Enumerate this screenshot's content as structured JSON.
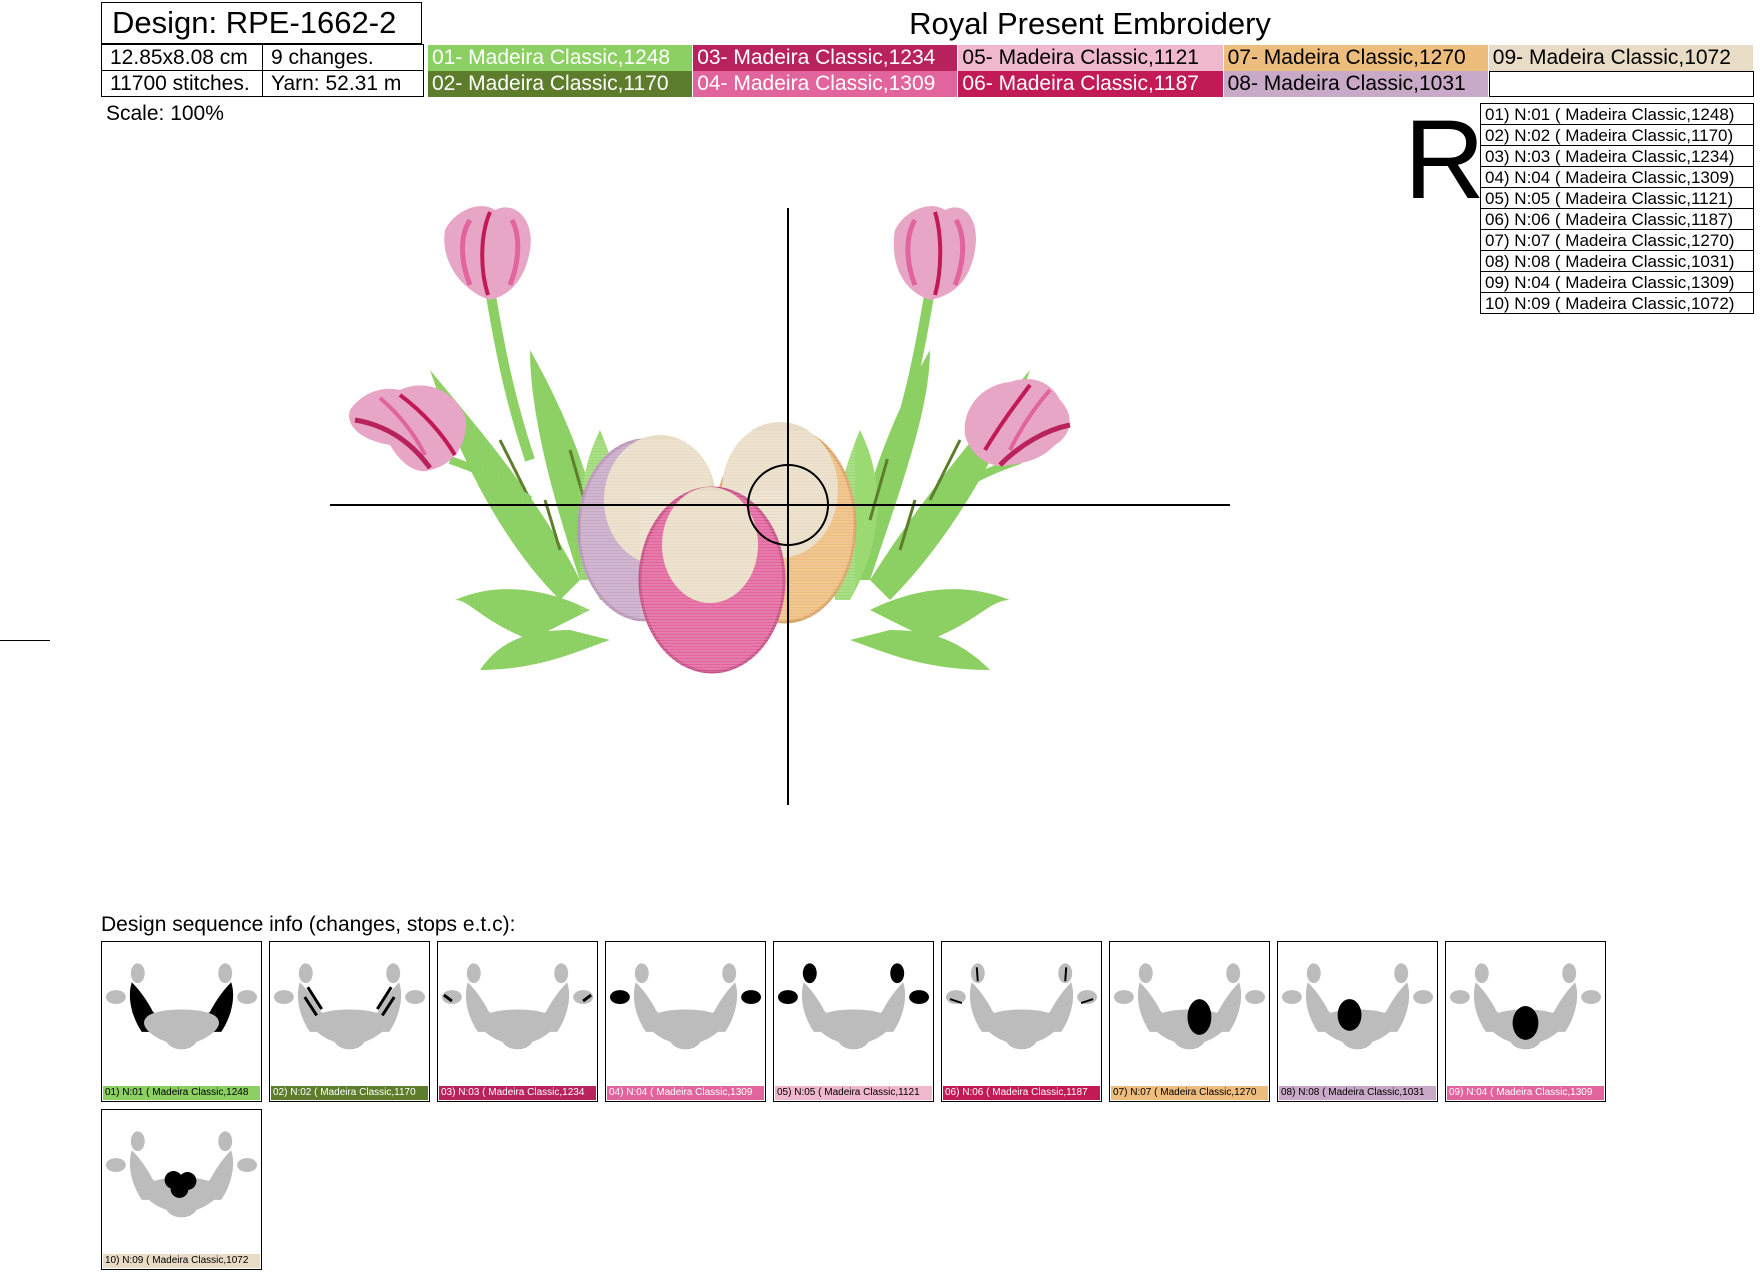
{
  "header": {
    "design": "Design: RPE-1662-2",
    "company": "Royal Present Embroidery",
    "size": "12.85x8.08 cm",
    "changes": "9 changes.",
    "stitches": "11700 stitches.",
    "yarn": "Yarn: 52.31 m",
    "scale": "Scale: 100%",
    "orientation": "R"
  },
  "palette": [
    {
      "label": "01- Madeira Classic,1248",
      "color": "#8ccf62",
      "text": "#ffffff"
    },
    {
      "label": "03- Madeira Classic,1234",
      "color": "#b9235d",
      "text": "#ffffff"
    },
    {
      "label": "05- Madeira Classic,1121",
      "color": "#f0b8cc",
      "text": "#000000"
    },
    {
      "label": "07- Madeira Classic,1270",
      "color": "#edbd7e",
      "text": "#000000"
    },
    {
      "label": "09- Madeira Classic,1072",
      "color": "#e9dcc6",
      "text": "#000000"
    },
    {
      "label": "02- Madeira Classic,1170",
      "color": "#5e7d2c",
      "text": "#ffffff"
    },
    {
      "label": "04- Madeira Classic,1309",
      "color": "#e1659c",
      "text": "#ffffff"
    },
    {
      "label": "06- Madeira Classic,1187",
      "color": "#c11a57",
      "text": "#ffffff"
    },
    {
      "label": "08- Madeira Classic,1031",
      "color": "#c9a9c8",
      "text": "#000000"
    },
    {
      "label": "",
      "color": "#ffffff",
      "text": "#000000"
    }
  ],
  "thread_list": [
    "01) N:01 ( Madeira Classic,1248)",
    "02) N:02 ( Madeira Classic,1170)",
    "03) N:03 ( Madeira Classic,1234)",
    "04) N:04 ( Madeira Classic,1309)",
    "05) N:05 ( Madeira Classic,1121)",
    "06) N:06 ( Madeira Classic,1187)",
    "07) N:07 ( Madeira Classic,1270)",
    "08) N:08 ( Madeira Classic,1031)",
    "09) N:04 ( Madeira Classic,1309)",
    "10) N:09 ( Madeira Classic,1072)"
  ],
  "sequence": {
    "title": "Design sequence info (changes, stops e.t.c):",
    "steps": [
      {
        "label": "01) N:01 ( Madeira Classic,1248",
        "color": "#8ccf62",
        "text": "#000000",
        "highlight": "leaves"
      },
      {
        "label": "02) N:02 ( Madeira Classic,1170",
        "color": "#5e7d2c",
        "text": "#ffffff",
        "highlight": "leaf-stripes"
      },
      {
        "label": "03) N:03 ( Madeira Classic,1234",
        "color": "#b9235d",
        "text": "#ffffff",
        "highlight": "side-tulip-edges"
      },
      {
        "label": "04) N:04 ( Madeira Classic,1309",
        "color": "#e1659c",
        "text": "#ffffff",
        "highlight": "side-tulips"
      },
      {
        "label": "05) N:05 ( Madeira Classic,1121",
        "color": "#f0b8cc",
        "text": "#000000",
        "highlight": "all-tulips"
      },
      {
        "label": "06) N:06 ( Madeira Classic,1187",
        "color": "#c11a57",
        "text": "#ffffff",
        "highlight": "tulip-stripes"
      },
      {
        "label": "07) N:07 ( Madeira Classic,1270",
        "color": "#edbd7e",
        "text": "#000000",
        "highlight": "egg-right"
      },
      {
        "label": "08) N:08 ( Madeira Classic,1031",
        "color": "#c9a9c8",
        "text": "#000000",
        "highlight": "egg-left"
      },
      {
        "label": "09) N:04 ( Madeira Classic,1309",
        "color": "#e1659c",
        "text": "#ffffff",
        "highlight": "egg-front"
      },
      {
        "label": "10) N:09 ( Madeira Classic,1072",
        "color": "#e9dcc6",
        "text": "#000000",
        "highlight": "egg-centers"
      }
    ]
  }
}
